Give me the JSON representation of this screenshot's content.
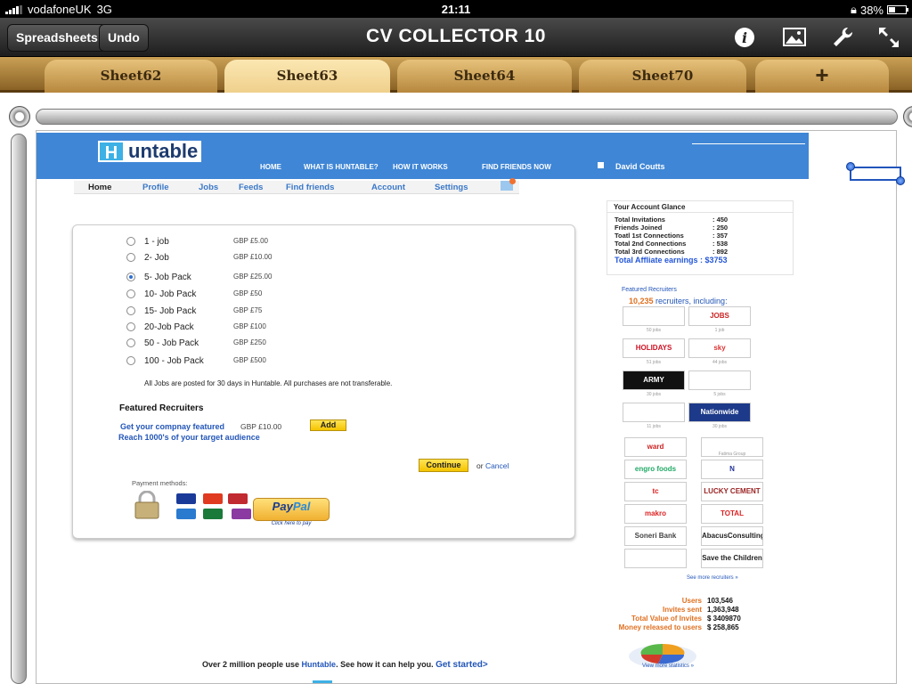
{
  "status_bar": {
    "carrier": "vodafoneUK",
    "network": "3G",
    "time": "21:11",
    "battery": "38%",
    "battery_fraction": 0.38
  },
  "toolbar": {
    "spreadsheets_label": "Spreadsheets",
    "undo_label": "Undo",
    "title": "CV COLLECTOR  10",
    "icons": [
      "info-icon",
      "image-icon",
      "wrench-icon",
      "expand-icon"
    ]
  },
  "sheet_tabs": [
    {
      "label": "Sheet62",
      "active": false
    },
    {
      "label": "Sheet63",
      "active": true
    },
    {
      "label": "Sheet64",
      "active": false
    },
    {
      "label": "Sheet70",
      "active": false
    }
  ],
  "add_sheet_label": "+",
  "web": {
    "logo": {
      "h": "H",
      "rest": "untable"
    },
    "nav": [
      "HOME",
      "WHAT IS HUNTABLE?",
      "HOW IT WORKS",
      "FIND FRIENDS NOW"
    ],
    "user_name": "David Coutts",
    "subnav": [
      "Home",
      "Profile",
      "Jobs",
      "Feeds",
      "Find friends",
      "Account",
      "Settings"
    ],
    "jobs": [
      {
        "label": "1 - job",
        "price": "GBP £5.00",
        "selected": false
      },
      {
        "label": "2- Job",
        "price": "GBP £10.00",
        "selected": false
      },
      {
        "label": "5- Job Pack",
        "price": "GBP £25.00",
        "selected": true
      },
      {
        "label": "10- Job Pack",
        "price": "GBP £50",
        "selected": false
      },
      {
        "label": "15- Job Pack",
        "price": "GBP £75",
        "selected": false
      },
      {
        "label": "20-Job Pack",
        "price": "GBP £100",
        "selected": false
      },
      {
        "label": "50 - Job Pack",
        "price": "GBP £250",
        "selected": false
      },
      {
        "label": "100 - Job Pack",
        "price": "GBP £500",
        "selected": false
      }
    ],
    "note": "All Jobs are posted for 30 days in Huntable. All purchases are not transferable.",
    "featured": {
      "title": "Featured  Recruiters",
      "link": "Get your compnay featured",
      "price": "GBP £10.00",
      "add": "Add",
      "reach": "Reach 1000's of your target audience"
    },
    "continue_label": "Continue",
    "or_label": "or",
    "cancel_label": "Cancel",
    "payment_label": "Payment methods:",
    "paypal": {
      "pay": "Pay",
      "pal": "Pal",
      "sub": "Click here to pay"
    },
    "glance": {
      "title": "Your Account Glance",
      "rows": [
        {
          "label": "Total Invitations",
          "value": ": 450"
        },
        {
          "label": "Friends Joined",
          "value": ": 250"
        },
        {
          "label": "Toatl 1st Connections",
          "value": ": 357"
        },
        {
          "label": "Total 2nd Connections",
          "value": ": 538"
        },
        {
          "label": "Total 3rd Connections",
          "value": ": 892"
        }
      ],
      "earnings": "Total Affliate earnings : $3753"
    },
    "featured_col": {
      "label": "Featured Recruiters",
      "count": "10,235",
      "count_suffix": " recruiters, including:",
      "logos": [
        {
          "name": "",
          "cap": "50 jobs",
          "color": "#3aa"
        },
        {
          "name": "JOBS",
          "cap": "1 job",
          "color": "#c22"
        },
        {
          "name": "HOLIDAYS",
          "cap": "51 jobs",
          "color": "#c12"
        },
        {
          "name": "sky",
          "cap": "44 jobs",
          "color": "#d33"
        },
        {
          "name": "ARMY",
          "cap": "30 jobs",
          "color": "#fff"
        },
        {
          "name": "",
          "cap": "5 jobs",
          "color": "#c22"
        },
        {
          "name": "",
          "cap": "11 jobs",
          "color": "#28c"
        },
        {
          "name": "Nationwide",
          "cap": "30 jobs",
          "color": "#fff"
        },
        {
          "name": "ward",
          "cap": "",
          "color": "#c22"
        },
        {
          "name": "",
          "cap": "Fatima Group",
          "color": "#2a4"
        },
        {
          "name": "engro foods",
          "cap": "",
          "color": "#2a6"
        },
        {
          "name": "N",
          "cap": "",
          "color": "#239"
        },
        {
          "name": "tc",
          "cap": "",
          "color": "#d22"
        },
        {
          "name": "LUCKY CEMENT",
          "cap": "",
          "color": "#922"
        },
        {
          "name": "makro",
          "cap": "",
          "color": "#d22"
        },
        {
          "name": "TOTAL",
          "cap": "",
          "color": "#d22"
        },
        {
          "name": "Soneri Bank",
          "cap": "",
          "color": "#444"
        },
        {
          "name": "AbacusConsulting",
          "cap": "",
          "color": "#222"
        },
        {
          "name": "",
          "cap": "",
          "color": "#2a4"
        },
        {
          "name": "Save the Children",
          "cap": "",
          "color": "#222"
        }
      ],
      "see_more": "See more recruiters »"
    },
    "stats": [
      {
        "label": "Users",
        "value": "103,546"
      },
      {
        "label": "Invites sent",
        "value": "1,363,948"
      },
      {
        "label": "Total Value of Invites",
        "value": "$ 3409870"
      },
      {
        "label": "Money released to users",
        "value": "$ 258,865"
      }
    ],
    "more_stats": "View more statistics »",
    "bottom": {
      "pre": "Over 2 million people use ",
      "link": "Huntable",
      "mid": ". See how it can help you. ",
      "cta": "Get started>"
    }
  }
}
